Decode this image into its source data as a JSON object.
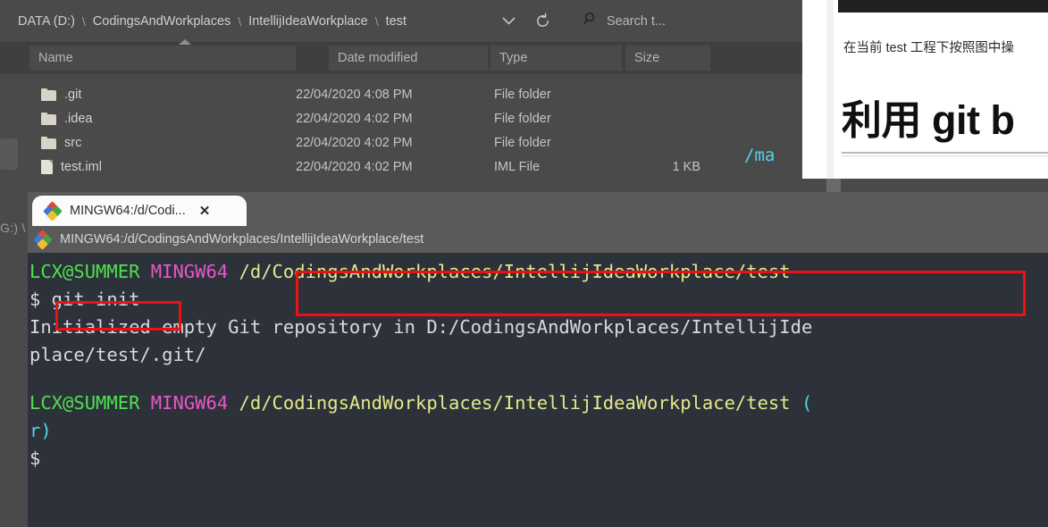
{
  "explorer": {
    "breadcrumb": {
      "items": [
        "DATA (D:)",
        "CodingsAndWorkplaces",
        "IntellijIdeaWorkplace",
        "test"
      ],
      "separator": "\\"
    },
    "toolbar": {
      "chevron_down": "˅",
      "refresh_icon": "refresh-icon",
      "search_icon": "search-icon",
      "search_placeholder": "Search t..."
    },
    "columns": [
      {
        "label": "Name",
        "sort": "ascending"
      },
      {
        "label": "Date modified"
      },
      {
        "label": "Type"
      },
      {
        "label": "Size"
      }
    ],
    "files": [
      {
        "icon": "folder-icon",
        "name": ".git",
        "date": "22/04/2020 4:08 PM",
        "type": "File folder",
        "size": ""
      },
      {
        "icon": "folder-icon",
        "name": ".idea",
        "date": "22/04/2020 4:02 PM",
        "type": "File folder",
        "size": ""
      },
      {
        "icon": "folder-icon",
        "name": "src",
        "date": "22/04/2020 4:02 PM",
        "type": "File folder",
        "size": ""
      },
      {
        "icon": "file-icon",
        "name": "test.iml",
        "date": "22/04/2020 4:02 PM",
        "type": "IML File",
        "size": "1 KB"
      }
    ],
    "stray_fragment": "G:) \\"
  },
  "document": {
    "paragraph": "在当前 test 工程下按照图中操",
    "heading": "利用 git b"
  },
  "ghost_window": {
    "breadcrumb": "DATA (D:)  \\  CodingsAndWorkplaces  \\",
    "column_label": "Name",
    "rows": [
      ".idea",
      "src",
      "test.iml"
    ],
    "traffic_lights": [
      {
        "name": "green-dot",
        "color": "#35bb35"
      },
      {
        "name": "yellow-dot",
        "color": "#e0bc24"
      },
      {
        "name": "red-dot",
        "color": "#e55555"
      }
    ]
  },
  "terminal": {
    "tab": {
      "label": "MINGW64:/d/Codi...",
      "close": "✕",
      "icon": "git-bash-icon"
    },
    "title": "MINGW64:/d/CodingsAndWorkplaces/IntellijIdeaWorkplace/test",
    "title_icon": "git-bash-icon",
    "lines": [
      {
        "segments": [
          {
            "text": "LCX@SUMMER",
            "color": "green"
          },
          {
            "text": " ",
            "color": "white"
          },
          {
            "text": "MINGW64",
            "color": "magenta"
          },
          {
            "text": " ",
            "color": "white"
          },
          {
            "text": "/d/CodingsAndWorkplaces/IntellijIdeaWorkplace/test",
            "color": "yellow"
          }
        ]
      },
      {
        "segments": [
          {
            "text": "$ git init",
            "color": "white"
          }
        ]
      },
      {
        "segments": [
          {
            "text": "Initialized empty Git repository in D:/CodingsAndWorkplaces/IntellijIde",
            "color": "white"
          }
        ]
      },
      {
        "segments": [
          {
            "text": "place/test/.git/",
            "color": "white"
          }
        ]
      },
      {
        "segments": [
          {
            "text": "LCX@SUMMER",
            "color": "green"
          },
          {
            "text": " ",
            "color": "white"
          },
          {
            "text": "MINGW64",
            "color": "magenta"
          },
          {
            "text": " ",
            "color": "white"
          },
          {
            "text": "/d/CodingsAndWorkplaces/IntellijIdeaWorkplace/test",
            "color": "yellow"
          },
          {
            "text": " ",
            "color": "white"
          },
          {
            "text": "(",
            "color": "cyan"
          }
        ]
      },
      {
        "segments": [
          {
            "text": "r)",
            "color": "cyan"
          }
        ]
      },
      {
        "segments": [
          {
            "text": "$",
            "color": "white"
          }
        ]
      }
    ],
    "stray_text": "/ma"
  },
  "annotations": {
    "path_box_color": "#ee1111",
    "command_box_color": "#ee1111"
  }
}
